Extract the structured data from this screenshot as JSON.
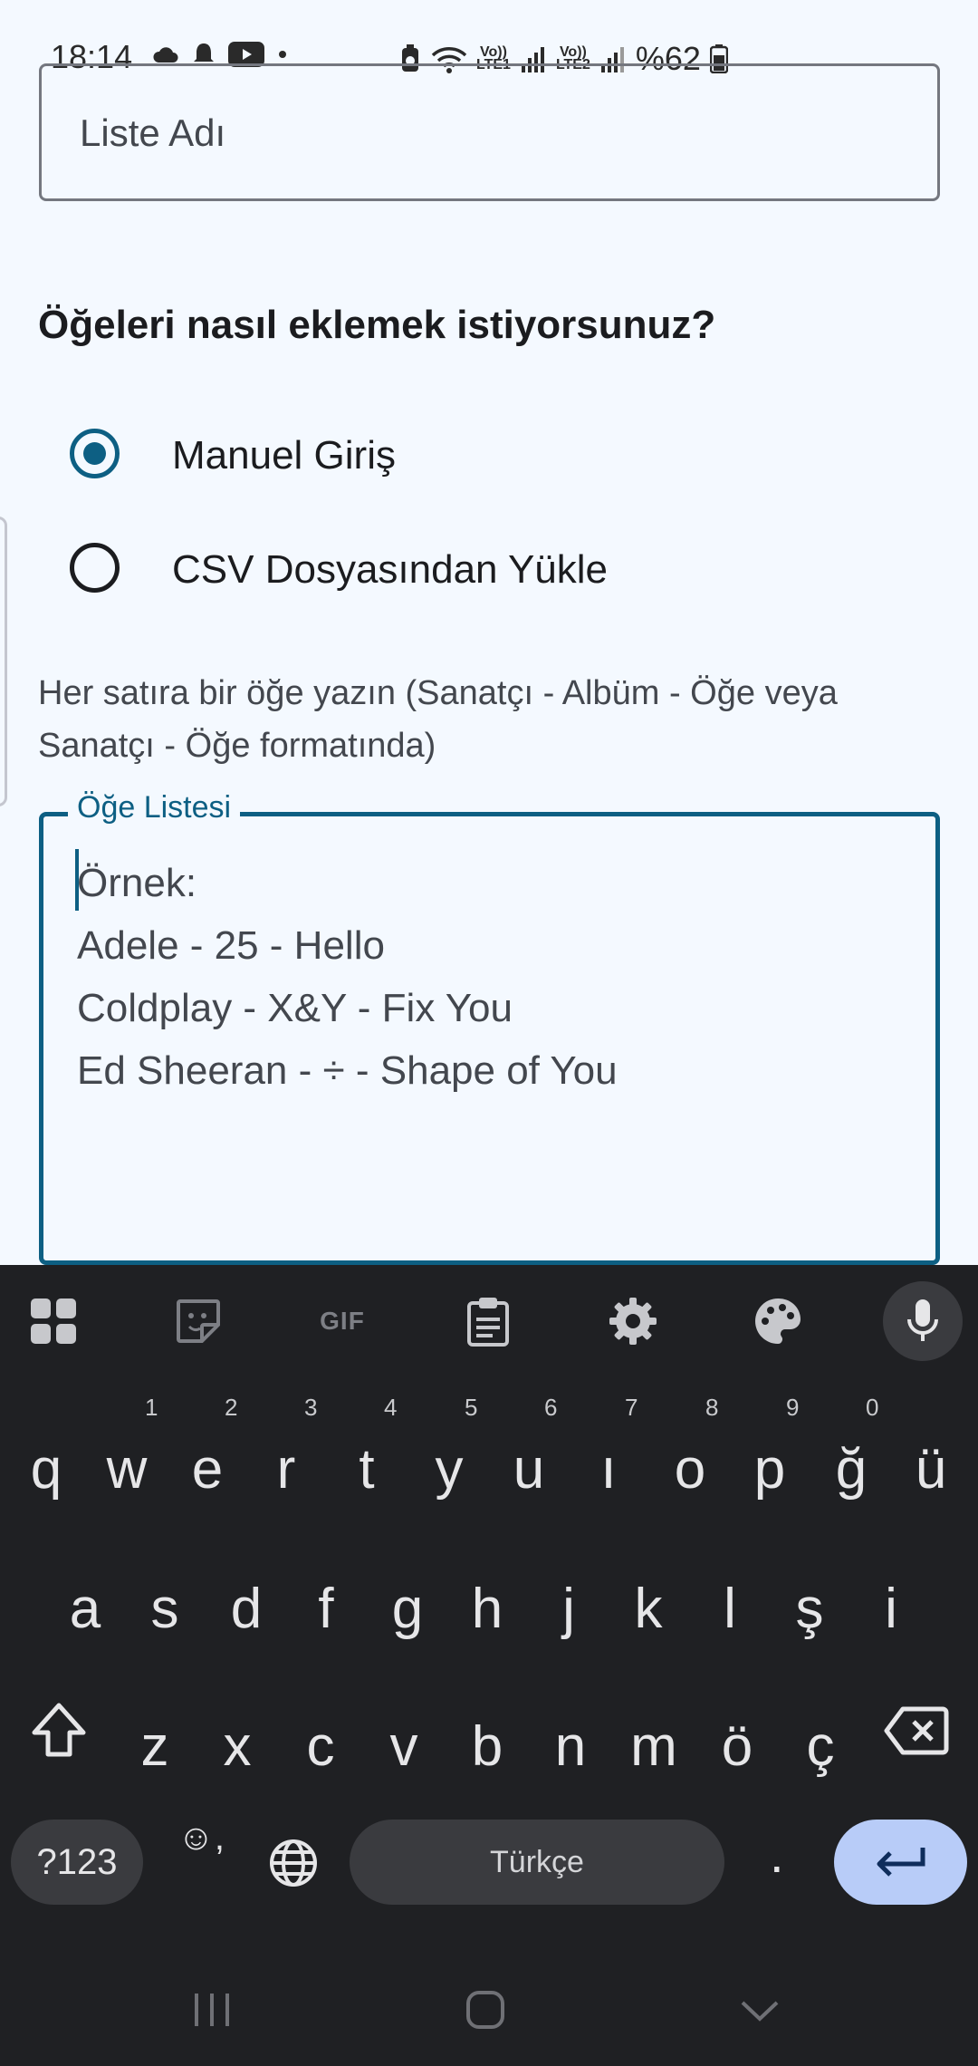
{
  "status_bar": {
    "time": "18:14",
    "battery": "%62",
    "sim1": "LTE1",
    "sim2": "LTE2",
    "volte": "Vo))"
  },
  "form": {
    "list_name_placeholder": "Liste Adı",
    "question": "Öğeleri nasıl eklemek istiyorsunuz?",
    "radio_options": [
      {
        "label": "Manuel Giriş",
        "selected": true
      },
      {
        "label": "CSV Dosyasından Yükle",
        "selected": false
      }
    ],
    "hint": "Her satıra bir öğe yazın (Sanatçı - Albüm - Öğe veya Sanatçı - Öğe formatında)",
    "items_label": "Öğe Listesi",
    "items_placeholder_lines": [
      "Örnek:",
      "Adele - 25 - Hello",
      "Coldplay - X&Y - Fix You",
      "Ed Sheeran - ÷ - Shape of You"
    ]
  },
  "keyboard": {
    "toolbar_icons": [
      "apps-grid-icon",
      "sticker-icon",
      "gif-icon",
      "clipboard-icon",
      "settings-icon",
      "palette-icon",
      "microphone-icon"
    ],
    "gif_label": "GIF",
    "row1": [
      "q",
      "w",
      "e",
      "r",
      "t",
      "y",
      "u",
      "ı",
      "o",
      "p",
      "ğ",
      "ü"
    ],
    "row1_numbers": [
      "1",
      "2",
      "3",
      "4",
      "5",
      "6",
      "7",
      "8",
      "9",
      "0"
    ],
    "row2": [
      "a",
      "s",
      "d",
      "f",
      "g",
      "h",
      "j",
      "k",
      "l",
      "ş",
      "i"
    ],
    "row3": [
      "z",
      "x",
      "c",
      "v",
      "b",
      "n",
      "m",
      "ö",
      "ç"
    ],
    "symbols_label": "?123",
    "emoji_label": "☺,",
    "space_label": "Türkçe",
    "period_label": ".",
    "accent_color": "#b8ccf8"
  },
  "colors": {
    "primary": "#0d5f83",
    "background": "#f4f9ff",
    "keyboard_bg": "#1f2023"
  }
}
